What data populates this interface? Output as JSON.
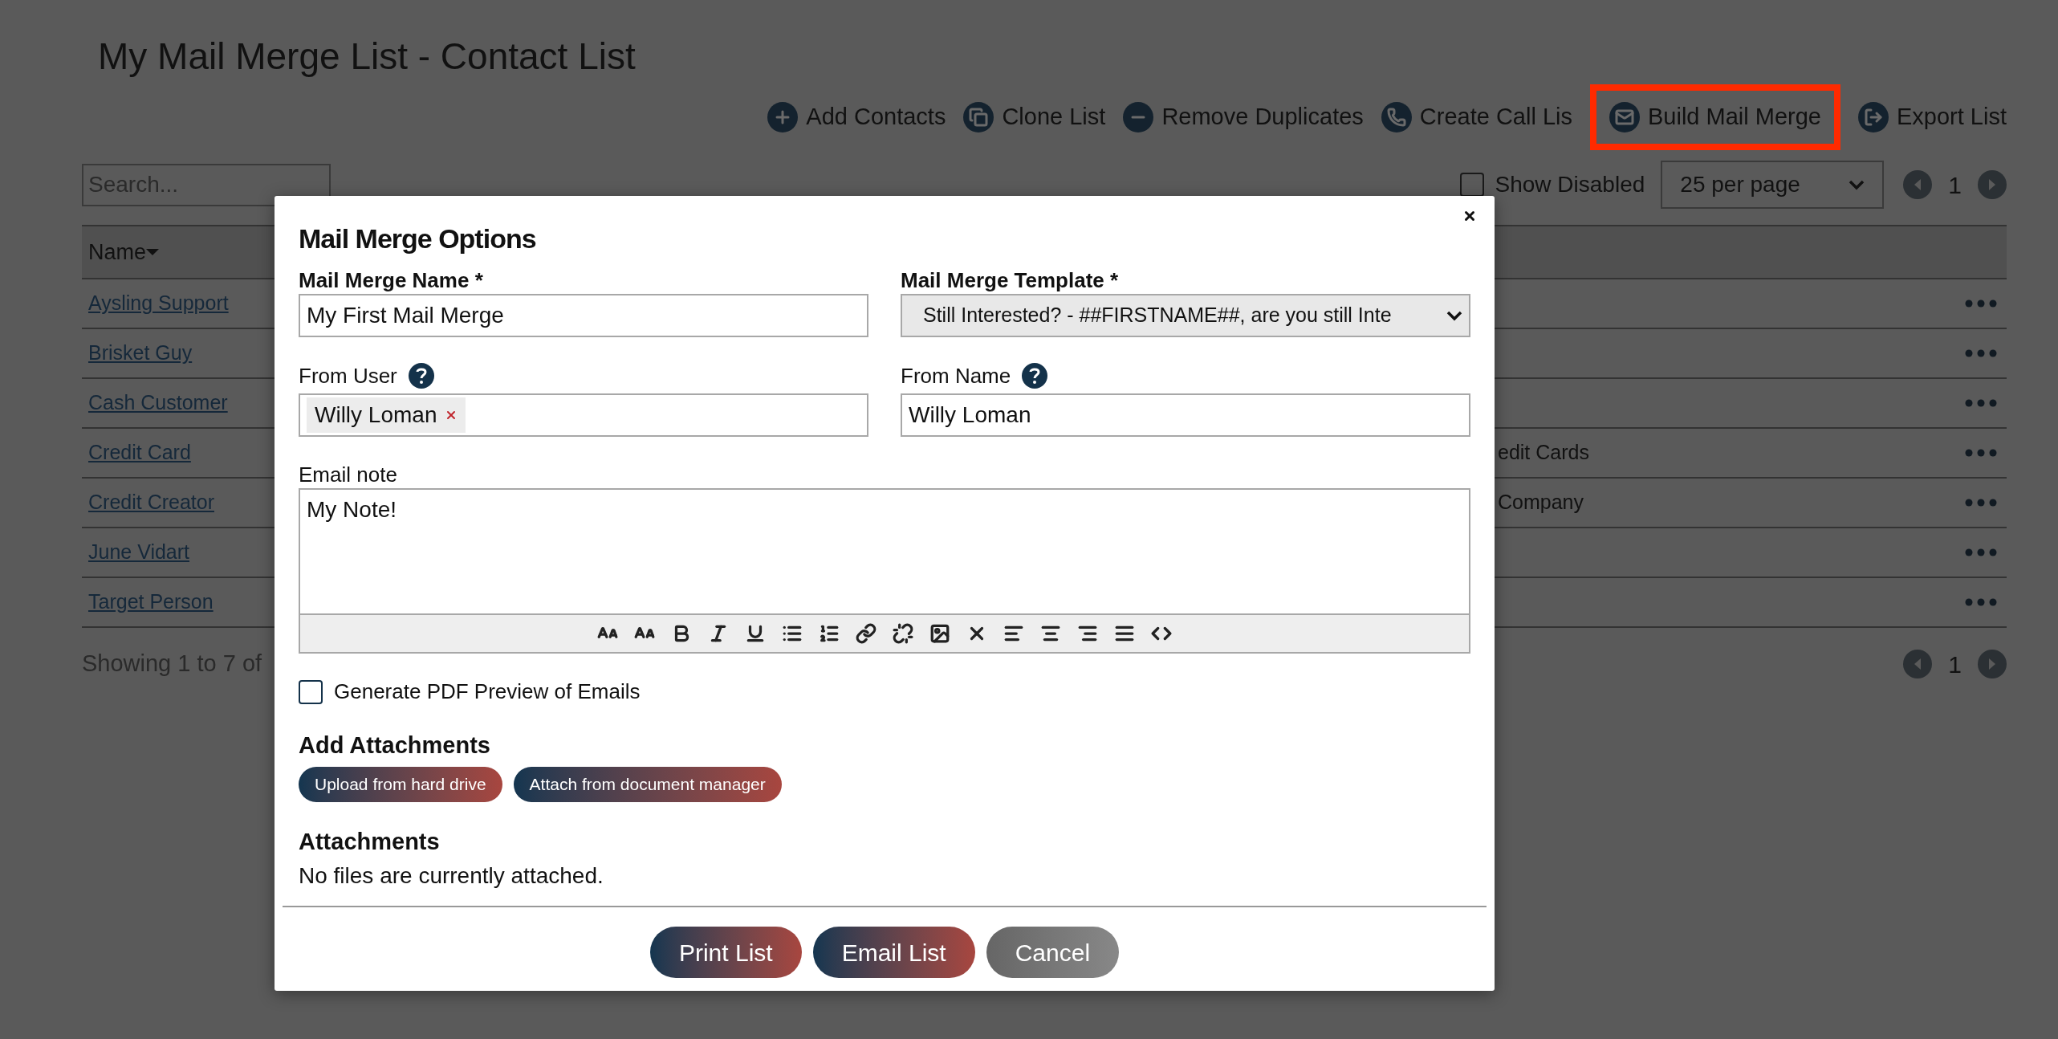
{
  "page": {
    "title": "My Mail Merge List - Contact List"
  },
  "toolbar": [
    {
      "label": "Add Contacts",
      "kind": "add",
      "highlighted": false
    },
    {
      "label": "Clone List",
      "kind": "clone",
      "highlighted": false
    },
    {
      "label": "Remove Duplicates",
      "kind": "remove",
      "highlighted": false
    },
    {
      "label": "Create Call Lis",
      "kind": "call",
      "highlighted": false
    },
    {
      "label": "Build Mail Merge",
      "kind": "mail",
      "highlighted": true
    },
    {
      "label": "Export List",
      "kind": "export",
      "highlighted": false
    }
  ],
  "search": {
    "placeholder": "Search..."
  },
  "show_disabled": {
    "label": "Show Disabled",
    "checked": false
  },
  "per_page": {
    "value": "25 per page"
  },
  "pagination_top": {
    "page": "1"
  },
  "table": {
    "columns": [
      {
        "label": "Name",
        "sorted": true
      }
    ],
    "rows": [
      {
        "name": "Aysling Support"
      },
      {
        "name": "Brisket Guy"
      },
      {
        "name": "Cash Customer"
      },
      {
        "name": "Credit Card",
        "column_3": "edit Cards"
      },
      {
        "name": "Credit Creator",
        "column_3": "Company"
      },
      {
        "name": "June Vidart"
      },
      {
        "name": "Target Person"
      }
    ]
  },
  "footer": {
    "summary": "Showing 1 to 7 of"
  },
  "pagination_bottom": {
    "page": "1"
  },
  "modal": {
    "title": "Mail Merge Options",
    "merge_name": {
      "label": "Mail Merge Name *",
      "value": "My First Mail Merge"
    },
    "template": {
      "label": "Mail Merge Template *",
      "value": "Still Interested? - ##FIRSTNAME##, are you still Inte"
    },
    "from_user": {
      "label": "From User",
      "tags": [
        "Willy Loman"
      ]
    },
    "from_name": {
      "label": "From Name",
      "value": "Willy Loman"
    },
    "email_note": {
      "label": "Email note",
      "value": "My Note!"
    },
    "pdf_preview": {
      "label": "Generate PDF Preview of Emails",
      "checked": false
    },
    "add_attachments": {
      "heading": "Add Attachments",
      "buttons": [
        "Upload from hard drive",
        "Attach from document manager"
      ]
    },
    "attachments": {
      "heading": "Attachments",
      "empty_text": "No files are currently attached."
    },
    "actions": [
      {
        "label": "Print List",
        "kind": "primary"
      },
      {
        "label": "Email List",
        "kind": "primary"
      },
      {
        "label": "Cancel",
        "kind": "secondary"
      }
    ]
  }
}
